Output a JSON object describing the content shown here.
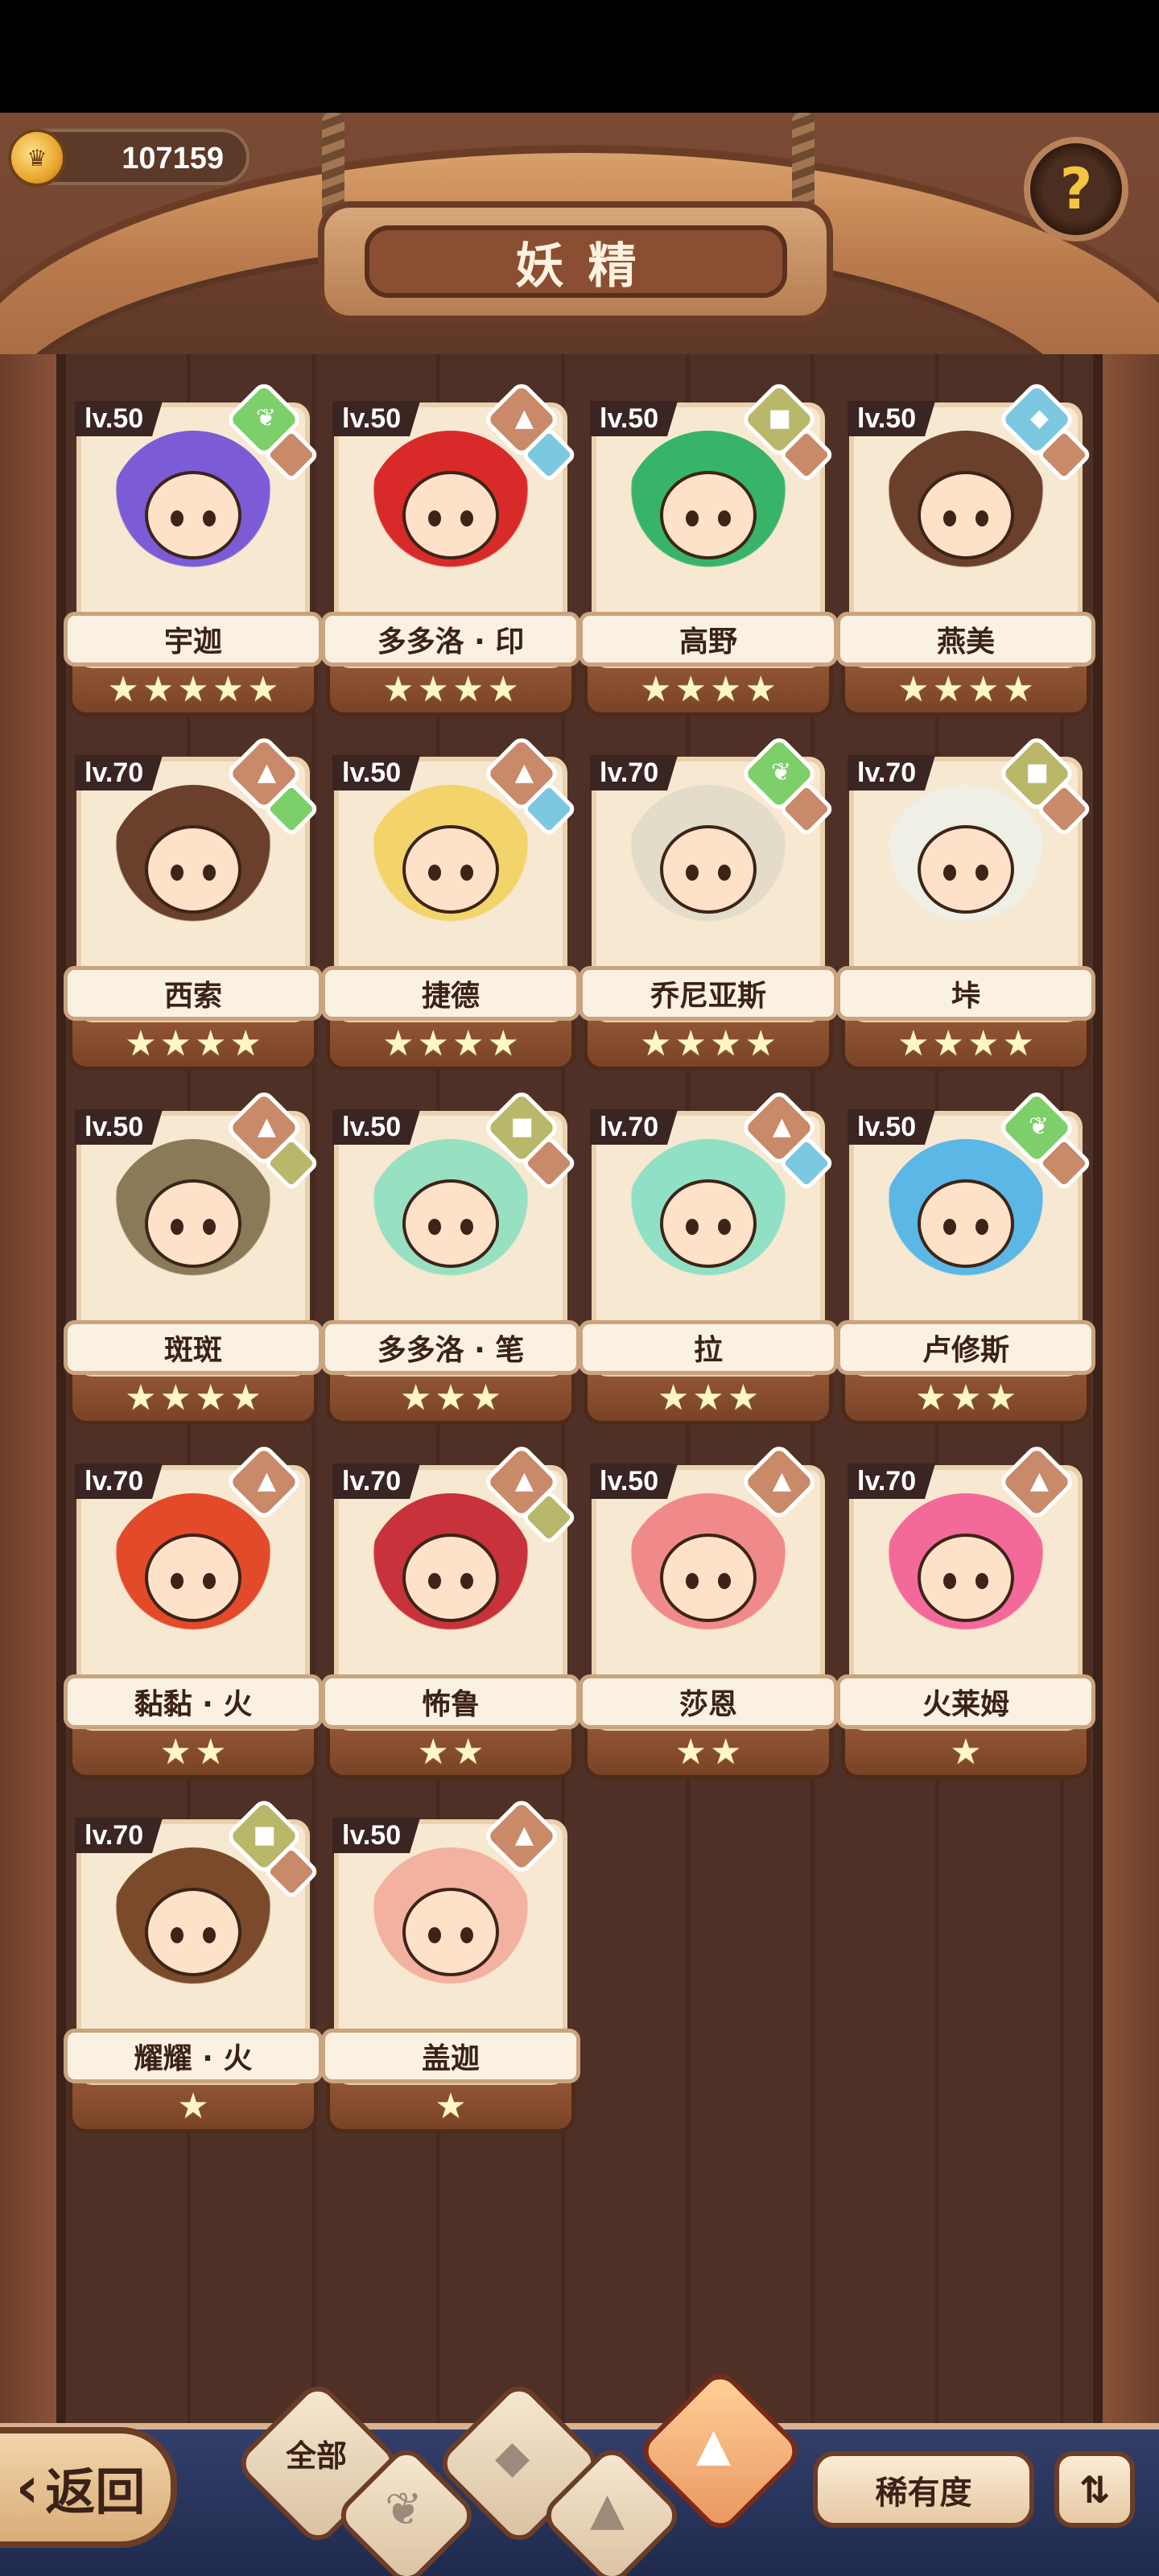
{
  "currency": {
    "icon": "crown-coin-icon",
    "value": "107159"
  },
  "title": "妖精",
  "help": {
    "icon": "help-icon",
    "glyph": "?"
  },
  "cards": [
    {
      "level": "lv.50",
      "name": "宇迦",
      "stars": 5,
      "element": "leaf",
      "sub": "earth",
      "portrait_color": "#7b5bd6"
    },
    {
      "level": "lv.50",
      "name": "多多洛 · 印",
      "stars": 4,
      "element": "earth",
      "sub": "water",
      "portrait_color": "#d92a2a"
    },
    {
      "level": "lv.50",
      "name": "高野",
      "stars": 4,
      "element": "rock",
      "sub": "earth",
      "portrait_color": "#38b46a"
    },
    {
      "level": "lv.50",
      "name": "燕美",
      "stars": 4,
      "element": "water",
      "sub": "earth",
      "portrait_color": "#6a3f2c"
    },
    {
      "level": "lv.70",
      "name": "西索",
      "stars": 4,
      "element": "earth",
      "sub": "leaf",
      "portrait_color": "#6a3f2c"
    },
    {
      "level": "lv.50",
      "name": "捷德",
      "stars": 4,
      "element": "earth",
      "sub": "water",
      "portrait_color": "#f2d46b"
    },
    {
      "level": "lv.70",
      "name": "乔尼亚斯",
      "stars": 4,
      "element": "leaf",
      "sub": "earth",
      "portrait_color": "#e3dcc8"
    },
    {
      "level": "lv.70",
      "name": "垰",
      "stars": 4,
      "element": "rock",
      "sub": "earth",
      "portrait_color": "#efefe6"
    },
    {
      "level": "lv.50",
      "name": "斑斑",
      "stars": 4,
      "element": "earth",
      "sub": "rock",
      "portrait_color": "#8a7a58"
    },
    {
      "level": "lv.50",
      "name": "多多洛 · 笔",
      "stars": 3,
      "element": "rock",
      "sub": "earth",
      "portrait_color": "#98e0c2"
    },
    {
      "level": "lv.70",
      "name": "拉",
      "stars": 3,
      "element": "earth",
      "sub": "water",
      "portrait_color": "#8fe0c5"
    },
    {
      "level": "lv.50",
      "name": "卢修斯",
      "stars": 3,
      "element": "leaf",
      "sub": "earth",
      "portrait_color": "#5ab7e6"
    },
    {
      "level": "lv.70",
      "name": "黏黏 · 火",
      "stars": 2,
      "element": "earth",
      "sub": "",
      "portrait_color": "#e24a2a"
    },
    {
      "level": "lv.70",
      "name": "怖鲁",
      "stars": 2,
      "element": "earth",
      "sub": "rock",
      "portrait_color": "#c8323a"
    },
    {
      "level": "lv.50",
      "name": "莎恩",
      "stars": 2,
      "element": "earth",
      "sub": "",
      "portrait_color": "#f08a8a"
    },
    {
      "level": "lv.70",
      "name": "火莱姆",
      "stars": 1,
      "element": "earth",
      "sub": "",
      "portrait_color": "#f36a9a"
    },
    {
      "level": "lv.70",
      "name": "耀耀 · 火",
      "stars": 1,
      "element": "rock",
      "sub": "earth",
      "portrait_color": "#7a4a2a"
    },
    {
      "level": "lv.50",
      "name": "盖迦",
      "stars": 1,
      "element": "earth",
      "sub": "",
      "portrait_color": "#f3b1a0"
    }
  ],
  "element_colors": {
    "leaf": "#7dcf6a",
    "earth": "#c98a6a",
    "water": "#7cc8e0",
    "rock": "#b9b86a"
  },
  "nav": {
    "back_label": "返回",
    "filters": [
      {
        "label": "全部",
        "active": false,
        "icon": ""
      },
      {
        "label": "",
        "active": false,
        "icon": "leaf-filter-icon"
      },
      {
        "label": "",
        "active": false,
        "icon": "water-filter-icon"
      },
      {
        "label": "",
        "active": false,
        "icon": "rock-filter-icon"
      },
      {
        "label": "",
        "active": true,
        "icon": "earth-filter-icon"
      }
    ],
    "rarity_label": "稀有度",
    "sort_icon": "sort-icon"
  }
}
